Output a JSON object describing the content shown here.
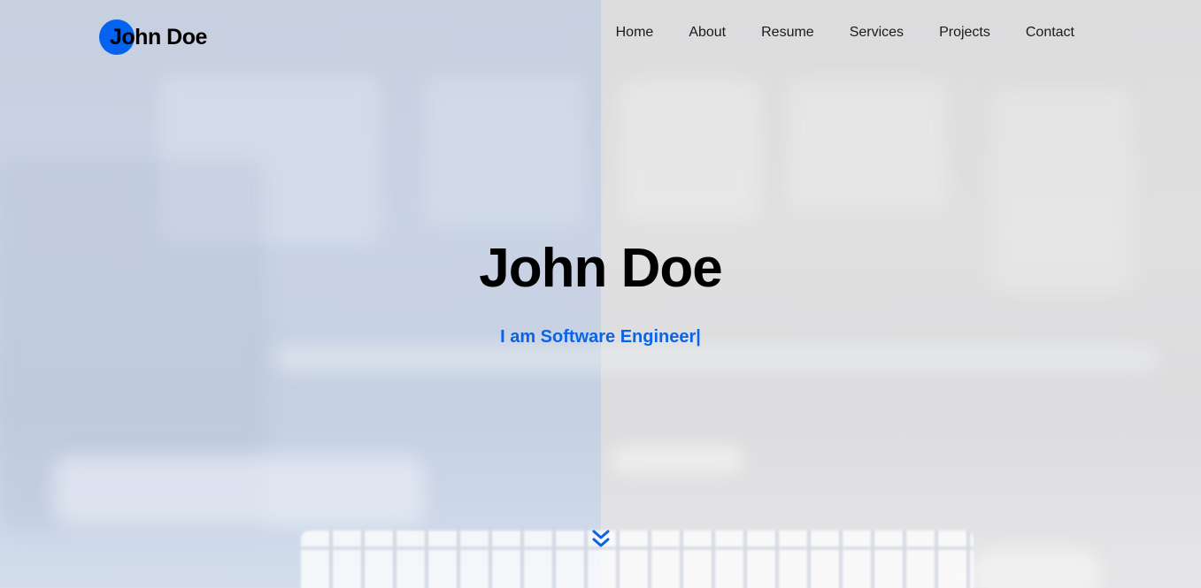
{
  "header": {
    "logo_text": "John Doe",
    "nav": [
      {
        "label": "Home"
      },
      {
        "label": "About"
      },
      {
        "label": "Resume"
      },
      {
        "label": "Services"
      },
      {
        "label": "Projects"
      },
      {
        "label": "Contact"
      }
    ]
  },
  "hero": {
    "title": "John Doe",
    "subtitle": "I am Software Engineer",
    "cursor": "|",
    "scroll_icon": "double-chevron-down-icon"
  },
  "colors": {
    "accent": "#0563f0",
    "title": "#000000",
    "subtitle": "#0b63e6"
  }
}
